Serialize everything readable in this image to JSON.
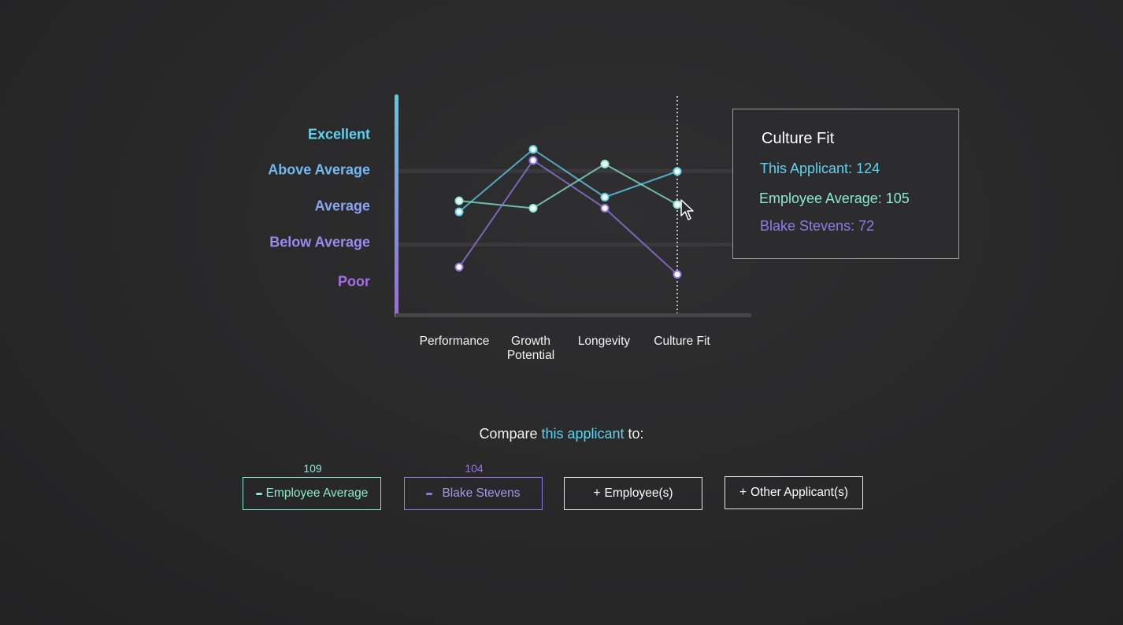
{
  "colors": {
    "applicant": "#5fd2ee",
    "employee_average": "#8be8cf",
    "blake": "#9479e6",
    "axis_top": "#5bc8e8",
    "axis_bottom": "#a066e8"
  },
  "y_axis": {
    "labels": [
      {
        "text": "Excellent",
        "color": "#5fd2ee"
      },
      {
        "text": "Above Average",
        "color": "#72b9f2"
      },
      {
        "text": "Average",
        "color": "#8aa3f2"
      },
      {
        "text": "Below Average",
        "color": "#9a8bef"
      },
      {
        "text": "Poor",
        "color": "#a56fe8"
      }
    ]
  },
  "chart_data": {
    "type": "line",
    "categories": [
      "Performance",
      "Growth Potential",
      "Longevity",
      "Culture Fit"
    ],
    "x_display": [
      "Performance",
      "Growth\nPotential",
      "Longevity",
      "Culture Fit"
    ],
    "y_levels": [
      "Poor",
      "Below Average",
      "Average",
      "Above Average",
      "Excellent"
    ],
    "series": [
      {
        "name": "This Applicant",
        "color": "#5fd2ee",
        "values": [
          2.9,
          4.6,
          3.3,
          4.0
        ]
      },
      {
        "name": "Employee Average",
        "color": "#8be8cf",
        "values": [
          3.2,
          3.0,
          4.2,
          3.1
        ]
      },
      {
        "name": "Blake Stevens",
        "color": "#9479e6",
        "values": [
          1.4,
          4.3,
          3.0,
          1.2
        ]
      }
    ],
    "highlighted_category": "Culture Fit",
    "grid": true
  },
  "tooltip": {
    "title": "Culture Fit",
    "rows": [
      {
        "text": "This Applicant: 124",
        "color": "#5fd2ee"
      },
      {
        "text": "Employee Average: 105",
        "color": "#8be8cf"
      },
      {
        "text": "Blake Stevens: 72",
        "color": "#9479e6"
      }
    ]
  },
  "compare": {
    "prefix": "Compare ",
    "highlight": "this applicant",
    "suffix": " to:"
  },
  "buttons": {
    "employee_average": {
      "label": "Employee Average",
      "count": "109",
      "color": "#8be8cf"
    },
    "blake": {
      "label": "Blake Stevens",
      "count": "104",
      "color": "#9479e6"
    },
    "add_employee": {
      "plus": "+",
      "label": "Employee(s)"
    },
    "add_applicant": {
      "plus": "+",
      "label": "Other Applicant(s)"
    }
  }
}
